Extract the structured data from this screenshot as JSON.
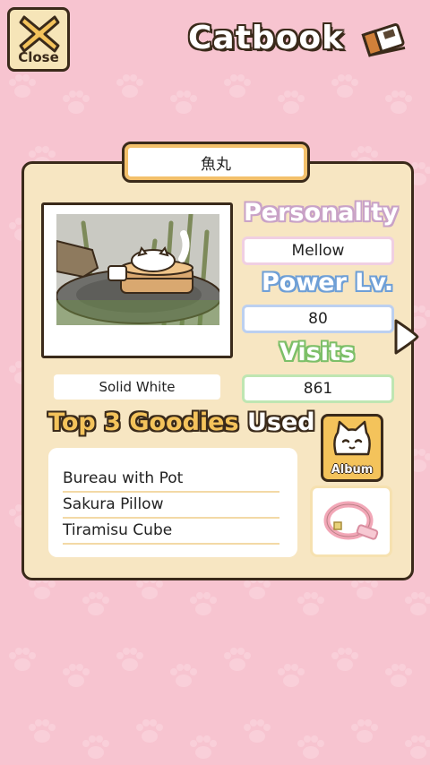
{
  "header": {
    "close_label": "Close",
    "title": "Catbook"
  },
  "cat": {
    "name": "魚丸",
    "pattern": "Solid White"
  },
  "stats": {
    "personality_heading": "Personality",
    "personality": "Mellow",
    "power_heading": "Power Lv.",
    "power": "80",
    "visits_heading": "Visits",
    "visits": "861"
  },
  "goodies": {
    "heading_top": "Top 3",
    "heading_goodies": "Goodies",
    "heading_used": "Used",
    "items": [
      "Bureau with Pot",
      "Sakura Pillow",
      "Tiramisu Cube"
    ]
  },
  "album": {
    "label": "Album"
  },
  "colors": {
    "background": "#f7c4d0",
    "card": "#f7e6c2",
    "accent_yellow": "#f4c35b",
    "outline": "#3a2a1a"
  },
  "icons": [
    "close-x-icon",
    "book-icon",
    "next-arrow-icon",
    "cat-face-icon",
    "collar-icon",
    "paw-print-icon"
  ]
}
